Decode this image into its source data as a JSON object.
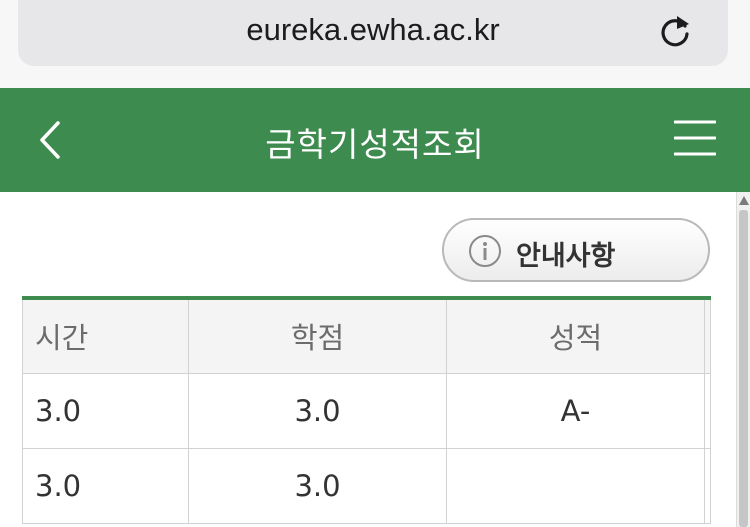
{
  "browser": {
    "url": "eureka.ewha.ac.kr",
    "reload_icon": "reload-icon"
  },
  "header": {
    "title": "금학기성적조회",
    "back_icon": "chevron-left-icon",
    "menu_icon": "hamburger-menu-icon",
    "color": "#3e8b4f"
  },
  "notice_button": {
    "label": "안내사항",
    "icon": "info-icon"
  },
  "table": {
    "columns": [
      "시간",
      "학점",
      "성적"
    ],
    "rows": [
      {
        "time": "3.0",
        "credit": "3.0",
        "grade": "A-"
      },
      {
        "time": "3.0",
        "credit": "3.0",
        "grade": ""
      }
    ]
  }
}
